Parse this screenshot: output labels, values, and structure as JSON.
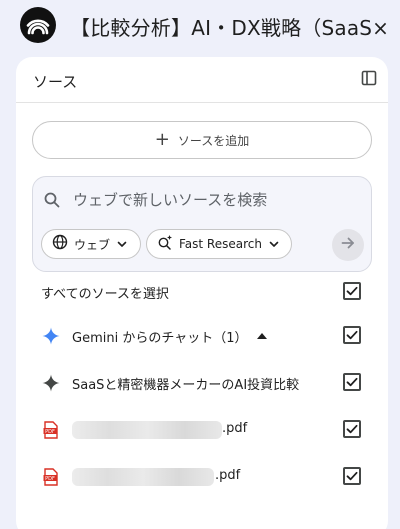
{
  "notebook": {
    "title": "【比較分析】AI・DX戦略（SaaS×"
  },
  "sources_panel": {
    "title": "ソース",
    "add_source_label": "ソースを追加",
    "search": {
      "placeholder": "ウェブで新しいソースを検索",
      "web_chip_label": "ウェブ",
      "research_chip_label": "Fast Research"
    },
    "select_all_label": "すべてのソースを選択",
    "items": [
      {
        "label": "Gemini からのチャット（1）",
        "icon": "gemini-sparkle-icon",
        "checked": true,
        "expanded": true
      },
      {
        "label": "SaaSと精密機器メーカーのAI投資比較",
        "icon": "sparkle-icon",
        "checked": true
      },
      {
        "label": ".pdf",
        "icon": "pdf-icon",
        "checked": true,
        "redacted": true
      },
      {
        "label": ".pdf",
        "icon": "pdf-icon",
        "checked": true,
        "redacted": true
      }
    ]
  },
  "colors": {
    "background": "#eef0fa",
    "panel": "#ffffff",
    "gemini_blue": "#4285f4",
    "pdf_red": "#d93025"
  }
}
